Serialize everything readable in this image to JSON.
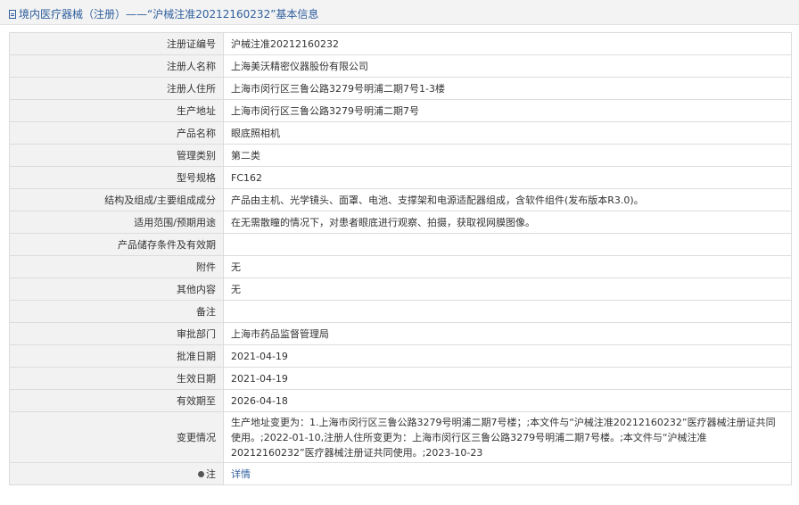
{
  "header": {
    "title": "境内医疗器械（注册）——“沪械注准20212160232”基本信息",
    "icon": "document-icon"
  },
  "rows": [
    {
      "label": "注册证编号",
      "value": "沪械注准20212160232"
    },
    {
      "label": "注册人名称",
      "value": "上海美沃精密仪器股份有限公司"
    },
    {
      "label": "注册人住所",
      "value": "上海市闵行区三鲁公路3279号明浦二期7号1-3楼"
    },
    {
      "label": "生产地址",
      "value": "上海市闵行区三鲁公路3279号明浦二期7号"
    },
    {
      "label": "产品名称",
      "value": "眼底照相机"
    },
    {
      "label": "管理类别",
      "value": "第二类"
    },
    {
      "label": "型号规格",
      "value": "FC162"
    },
    {
      "label": "结构及组成/主要组成成分",
      "value": "产品由主机、光学镜头、面罩、电池、支撑架和电源适配器组成，含软件组件(发布版本R3.0)。"
    },
    {
      "label": "适用范围/预期用途",
      "value": "在无需散瞳的情况下，对患者眼底进行观察、拍摄，获取视网膜图像。"
    },
    {
      "label": "产品储存条件及有效期",
      "value": ""
    },
    {
      "label": "附件",
      "value": "无"
    },
    {
      "label": "其他内容",
      "value": "无"
    },
    {
      "label": "备注",
      "value": ""
    },
    {
      "label": "审批部门",
      "value": "上海市药品监督管理局"
    },
    {
      "label": "批准日期",
      "value": "2021-04-19"
    },
    {
      "label": "生效日期",
      "value": "2021-04-19"
    },
    {
      "label": "有效期至",
      "value": "2026-04-18"
    }
  ],
  "change": {
    "label": "变更情况",
    "value": "生产地址变更为：1.上海市闵行区三鲁公路3279号明浦二期7号楼；;本文件与“沪械注准20212160232”医疗器械注册证共同使用。;2022-01-10,注册人住所变更为：上海市闵行区三鲁公路3279号明浦二期7号楼。;本文件与“沪械注准20212160232”医疗器械注册证共同使用。;2023-10-23"
  },
  "note": {
    "label": "注",
    "icon": "note-icon",
    "link_text": "详情"
  },
  "colors": {
    "header_bg": "#f3f3f3",
    "title_text": "#2f5f9e",
    "label_bg": "#f2f2f2",
    "border": "#dcdcdc",
    "link": "#2f5f9e"
  }
}
